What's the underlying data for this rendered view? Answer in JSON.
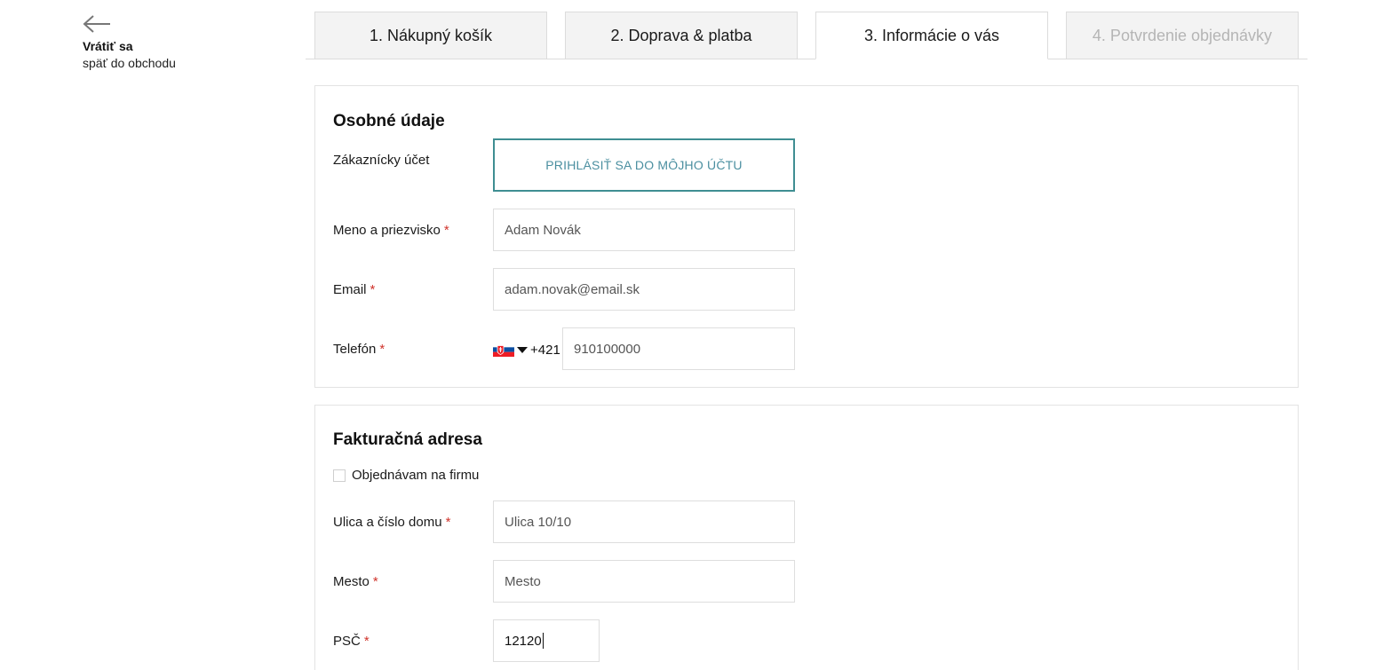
{
  "back": {
    "title": "Vrátiť sa",
    "subtitle": "späť do obchodu",
    "icon": "arrow-left-icon"
  },
  "steps": [
    {
      "label": "1. Nákupný košík",
      "state": "done"
    },
    {
      "label": "2. Doprava & platba",
      "state": "done"
    },
    {
      "label": "3. Informácie o vás",
      "state": "active"
    },
    {
      "label": "4. Potvrdenie objednávky",
      "state": "disabled"
    }
  ],
  "personal": {
    "title": "Osobné údaje",
    "account_label": "Zákaznícky účet",
    "login_button": "PRIHLÁSIŤ SA DO MÔJHO ÚČTU",
    "name_label": "Meno a priezvisko",
    "name_placeholder": "Adam Novák",
    "email_label": "Email",
    "email_placeholder": "adam.novak@email.sk",
    "phone_label": "Telefón",
    "phone_prefix": "+421",
    "phone_country_icon": "slovakia-flag-icon",
    "phone_placeholder": "910100000",
    "required_mark": "*"
  },
  "billing": {
    "title": "Fakturačná adresa",
    "company_checkbox_label": "Objednávam na firmu",
    "company_checked": false,
    "street_label": "Ulica a číslo domu",
    "street_placeholder": "Ulica 10/10",
    "city_label": "Mesto",
    "city_placeholder": "Mesto",
    "zip_label": "PSČ",
    "zip_value": "12120",
    "required_mark": "*"
  },
  "colors": {
    "accent": "#3f8e92",
    "required": "#d0342c",
    "tab_inactive_bg": "#f3f3f3"
  }
}
